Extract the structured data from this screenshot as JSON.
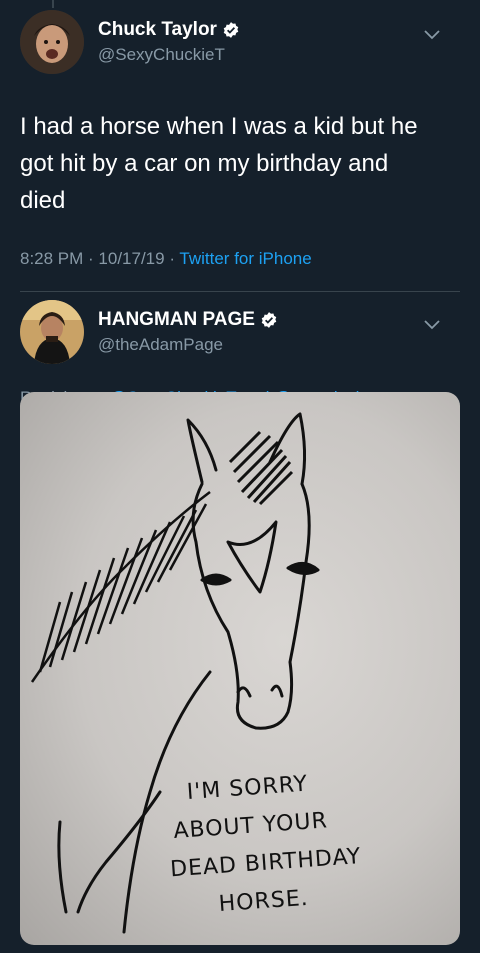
{
  "tweet": {
    "display_name": "Chuck Taylor",
    "handle": "@SexyChuckieT",
    "text_line1": "I had a horse when I was a kid but he",
    "text_line2": "got hit by a car on my birthday and",
    "text_line3": "died",
    "time": "8:28 PM · 10/17/19 · ",
    "source": "Twitter for iPhone"
  },
  "reply": {
    "display_name": "HANGMAN PAGE",
    "handle": "@theAdamPage",
    "replying_prefix": "Replying to ",
    "mention1": "@SexyChuckieT",
    "and_word": " and ",
    "mention2": "@trentylocks",
    "image_caption": {
      "line1": "I'M SORRY",
      "line2": "ABOUT YOUR",
      "line3": "DEAD BIRTHDAY",
      "line4": "HORSE."
    }
  },
  "icons": {
    "verified": "verified-badge-icon",
    "chevron": "chevron-down-icon"
  },
  "colors": {
    "background": "#15202b",
    "secondary_text": "#8899a6",
    "link": "#1da1f2",
    "divider": "#38444d"
  }
}
